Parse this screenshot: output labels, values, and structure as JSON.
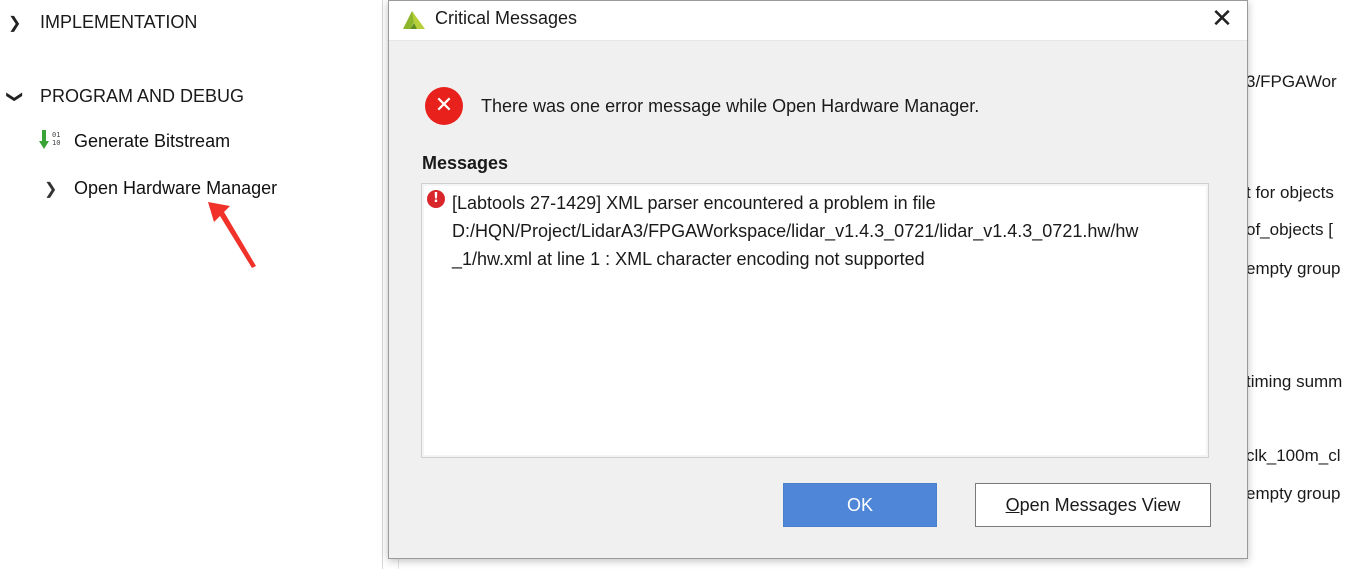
{
  "nav": {
    "implementation": "IMPLEMENTATION",
    "program_and_debug": "PROGRAM AND DEBUG",
    "generate_bitstream": "Generate Bitstream",
    "open_hardware_manager": "Open Hardware Manager",
    "bitstream_icon_text": "01\n10"
  },
  "background_text": [
    "3/FPGAWor",
    "t for objects",
    "of_objects [",
    "empty group",
    "timing summ",
    "clk_100m_cl",
    "empty group"
  ],
  "dialog": {
    "title": "Critical Messages",
    "summary": "There was one error message while Open Hardware Manager.",
    "messages_label": "Messages",
    "message_lines": [
      "[Labtools 27-1429] XML parser encountered a problem in file",
      "D:/HQN/Project/LidarA3/FPGAWorkspace/lidar_v1.4.3_0721/lidar_v1.4.3_0721.hw/hw",
      "_1/hw.xml at line 1 : XML character encoding not supported"
    ],
    "ok_label": "OK",
    "open_messages_first": "O",
    "open_messages_rest": "pen Messages View"
  },
  "colors": {
    "accent_button": "#4f86d7",
    "error_red": "#e8211d",
    "annotation_arrow": "#f0322a",
    "bitstream_green": "#3aa335"
  }
}
